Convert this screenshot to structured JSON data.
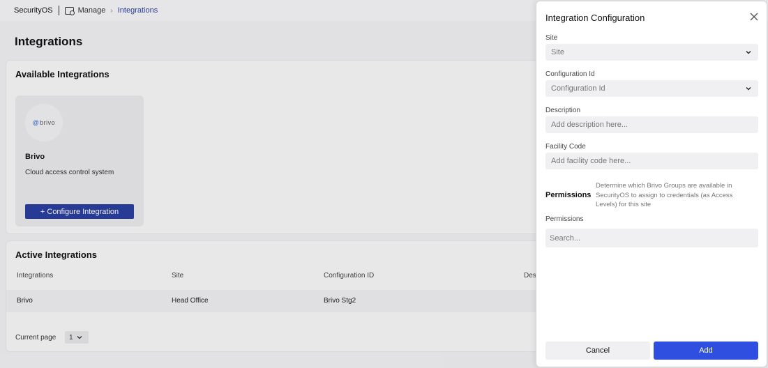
{
  "topbar": {
    "brand": "SecurityOS",
    "crumb_manage": "Manage",
    "crumb_integrations": "Integrations"
  },
  "page": {
    "title": "Integrations"
  },
  "available": {
    "title": "Available Integrations",
    "card": {
      "logo_text": "brivo",
      "name": "Brivo",
      "description": "Cloud access control system",
      "button": "+ Configure Integration"
    }
  },
  "active": {
    "title": "Active Integrations",
    "columns": [
      "Integrations",
      "Site",
      "Configuration ID",
      "Des"
    ],
    "rows": [
      {
        "integration": "Brivo",
        "site": "Head Office",
        "config_id": "Brivo Stg2"
      }
    ],
    "pager_label": "Current page",
    "pager_value": "1"
  },
  "drawer": {
    "title": "Integration Configuration",
    "site_label": "Site",
    "site_placeholder": "Site",
    "config_label": "Configuration Id",
    "config_placeholder": "Configuration Id",
    "description_label": "Description",
    "description_placeholder": "Add description here...",
    "facility_label": "Facility Code",
    "facility_placeholder": "Add facility code here...",
    "permissions_heading": "Permissions",
    "permissions_desc": "Determine which Brivo Groups are available in SecurityOS to assign to credentials (as Access Levels) for this site",
    "permissions_label": "Permissions",
    "permissions_placeholder": "Search...",
    "cancel": "Cancel",
    "add": "Add"
  },
  "colors": {
    "primary": "#2e4fe0",
    "configure_button": "#2a3fa0"
  }
}
